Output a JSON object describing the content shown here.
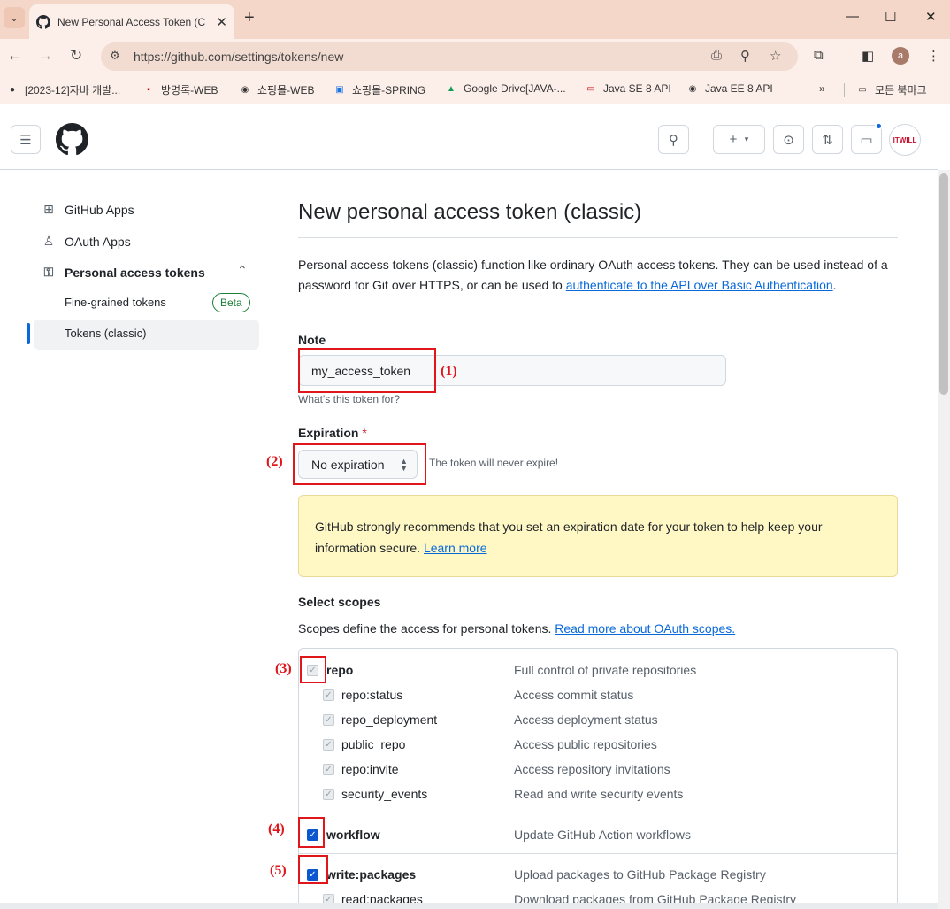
{
  "browser": {
    "tab_title": "New Personal Access Token (C",
    "url": "https://github.com/settings/tokens/new",
    "profile_initial": "a",
    "bookmarks": [
      "[2023-12]자바 개발...",
      "방명록-WEB",
      "쇼핑몰-WEB",
      "쇼핑몰-SPRING",
      "Google Drive[JAVA-...",
      "Java SE 8 API",
      "Java EE 8 API"
    ],
    "bookmarks_folder": "모든 북마크",
    "more": "»"
  },
  "sidebar": {
    "github_apps": "GitHub Apps",
    "oauth_apps": "OAuth Apps",
    "personal_tokens": "Personal access tokens",
    "fine_grained": "Fine-grained tokens",
    "beta": "Beta",
    "tokens_classic": "Tokens (classic)"
  },
  "main": {
    "title": "New personal access token (classic)",
    "intro": "Personal access tokens (classic) function like ordinary OAuth access tokens. They can be used instead of a password for Git over HTTPS, or can be used to ",
    "intro_link": "authenticate to the API over Basic Authentication",
    "intro_end": ".",
    "note_label": "Note",
    "note_value": "my_access_token",
    "note_hint": "What's this token for?",
    "expiration_label": "Expiration",
    "expiration_required": "*",
    "expiration_value": "No expiration",
    "expiration_hint": "The token will never expire!",
    "warning": "GitHub strongly recommends that you set an expiration date for your token to help keep your information secure. ",
    "warning_link": "Learn more",
    "scopes_heading": "Select scopes",
    "scopes_desc": "Scopes define the access for personal tokens. ",
    "scopes_link": "Read more about OAuth scopes."
  },
  "scopes": [
    {
      "name": "repo",
      "desc": "Full control of private repositories",
      "checked": true,
      "disabled": true,
      "sub": false
    },
    {
      "name": "repo:status",
      "desc": "Access commit status",
      "checked": true,
      "disabled": true,
      "sub": true
    },
    {
      "name": "repo_deployment",
      "desc": "Access deployment status",
      "checked": true,
      "disabled": true,
      "sub": true
    },
    {
      "name": "public_repo",
      "desc": "Access public repositories",
      "checked": true,
      "disabled": true,
      "sub": true
    },
    {
      "name": "repo:invite",
      "desc": "Access repository invitations",
      "checked": true,
      "disabled": true,
      "sub": true
    },
    {
      "name": "security_events",
      "desc": "Read and write security events",
      "checked": true,
      "disabled": true,
      "sub": true
    },
    {
      "name": "workflow",
      "desc": "Update GitHub Action workflows",
      "checked": true,
      "disabled": false,
      "sub": false
    },
    {
      "name": "write:packages",
      "desc": "Upload packages to GitHub Package Registry",
      "checked": true,
      "disabled": false,
      "sub": false
    },
    {
      "name": "read:packages",
      "desc": "Download packages from GitHub Package Registry",
      "checked": true,
      "disabled": true,
      "sub": true
    }
  ],
  "annotations": [
    "(1)",
    "(2)",
    "(3)",
    "(4)",
    "(5)"
  ],
  "colors": {
    "accent": "#0969da",
    "annotation": "#e0161b",
    "warning_bg": "#fff8c5"
  }
}
